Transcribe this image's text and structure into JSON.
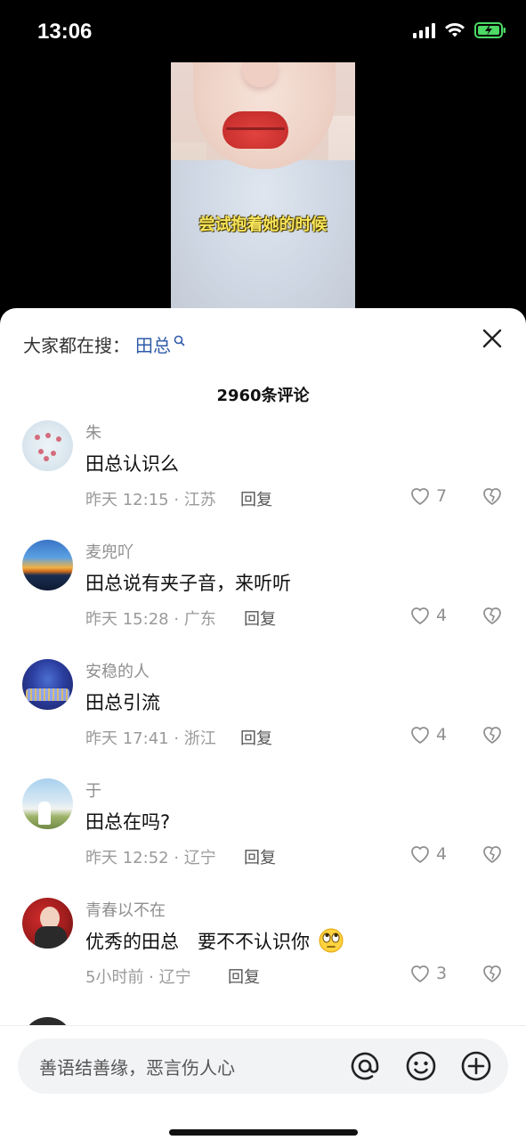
{
  "status": {
    "time": "13:06"
  },
  "video": {
    "subtitle": "尝试抱着她的时候"
  },
  "sheet": {
    "search_prefix": "大家都在搜：",
    "search_term": "田总",
    "count_label": "2960条评论",
    "input_placeholder": "善语结善缘，恶言伤人心"
  },
  "comments": [
    {
      "user": "朱",
      "text": "田总认识么",
      "meta": "昨天 12:15 · 江苏",
      "reply": "回复",
      "likes": "7"
    },
    {
      "user": "麦兜吖",
      "text": "田总说有夹子音，来听听",
      "meta": "昨天 15:28 · 广东",
      "reply": "回复",
      "likes": "4"
    },
    {
      "user": "安稳的人",
      "text": "田总引流",
      "meta": "昨天 17:41 · 浙江",
      "reply": "回复",
      "likes": "4"
    },
    {
      "user": "于",
      "text": "田总在吗?",
      "meta": "昨天 12:52 · 辽宁",
      "reply": "回复",
      "likes": "4"
    },
    {
      "user": "青春以不在",
      "text": "优秀的田总　要不不认识你",
      "meta": "5小时前 · 辽宁",
      "reply": "回复",
      "likes": "3"
    }
  ],
  "icons": {
    "close": "close-icon",
    "like": "heart-icon",
    "dislike": "broken-heart-icon",
    "mention": "at-icon",
    "emoji": "smiley-icon",
    "add": "plus-circle-icon",
    "inline_emoji": "rolling-eyes-emoji"
  },
  "colors": {
    "search_term": "#2f5aa8",
    "subtitle": "#f7e55a",
    "battery": "#4cd964"
  }
}
